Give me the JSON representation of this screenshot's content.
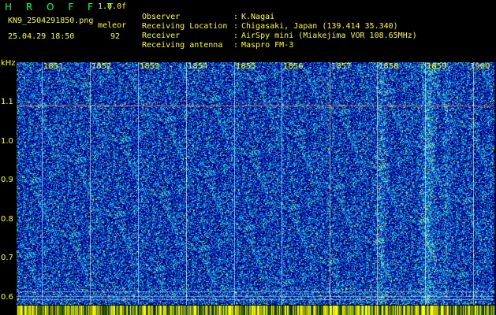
{
  "header": {
    "title": "H R O F F T",
    "version": "1.0.0f",
    "filename": "KN9_2504291850.png",
    "mode": "meleor",
    "datetime": "25.04.29 18:50",
    "count": "92"
  },
  "info": [
    {
      "key": "Observer",
      "sep": ":",
      "value": "K.Nagai"
    },
    {
      "key": "Receiving Location",
      "sep": ":",
      "value": "Chigasaki, Japan (139.414 35.340)"
    },
    {
      "key": "Receiver",
      "sep": ":",
      "value": "AirSpy mini (Miakejima VOR 108.65MHz)"
    },
    {
      "key": "Receiving antenna",
      "sep": ":",
      "value": "Maspro FM-3"
    }
  ],
  "axis": {
    "unit": "kHz",
    "x_ticks": [
      "1851",
      "1852",
      "1853",
      "1854",
      "1855",
      "1856",
      "1857",
      "1858",
      "1859",
      "1900"
    ],
    "y_ticks": [
      "1.1",
      "1.0",
      "0.9",
      "0.8",
      "0.7",
      "0.6"
    ]
  },
  "colors": {
    "background": "#000000",
    "text": "#ffff00",
    "title": "#00ff66",
    "plot_base": "#001a8c"
  }
}
